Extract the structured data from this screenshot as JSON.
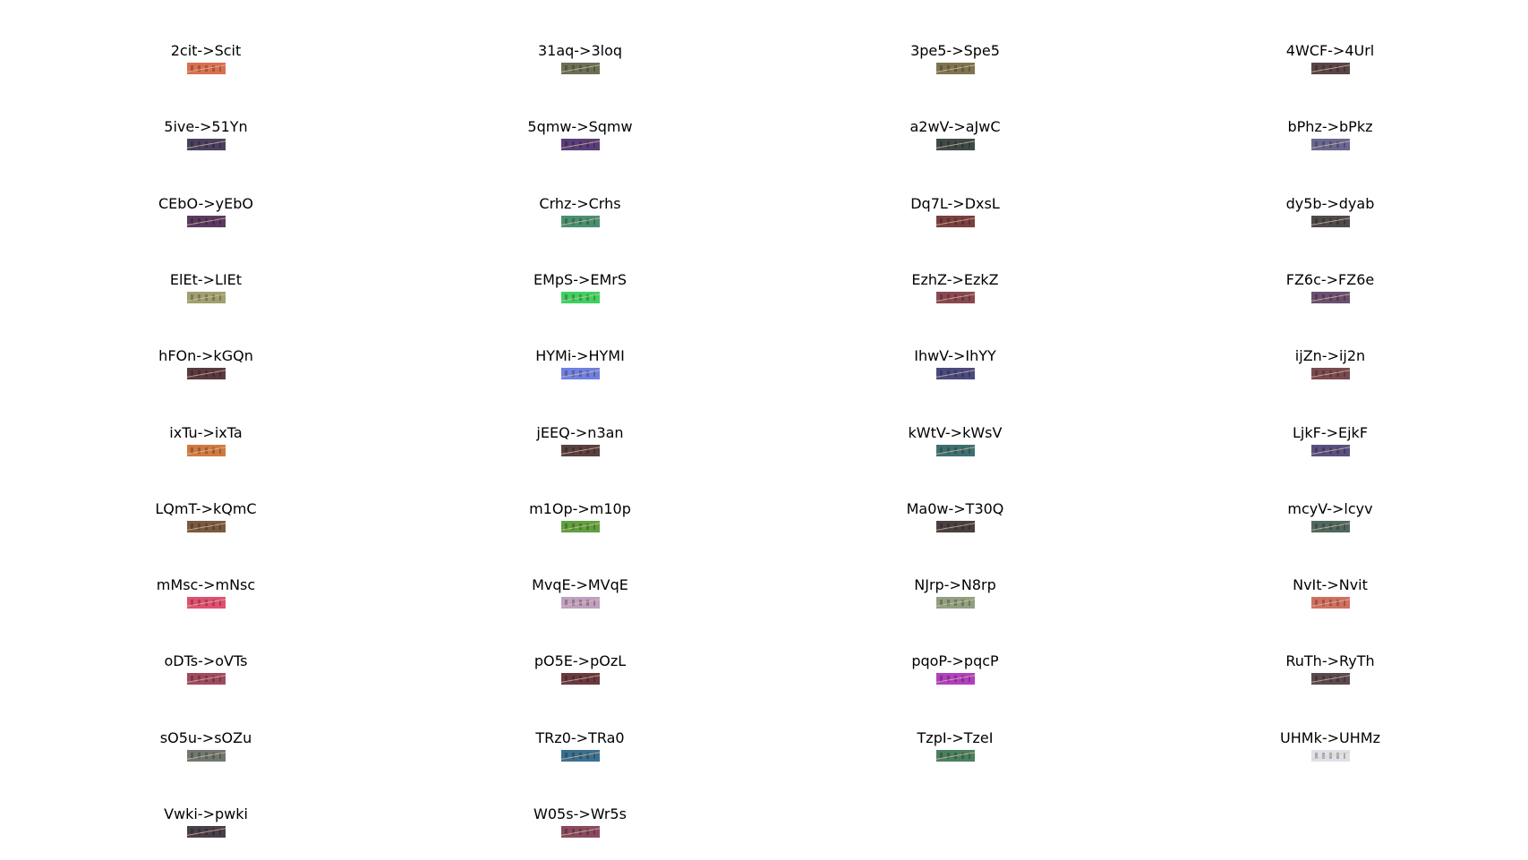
{
  "panels": [
    {
      "label": "2cit->Scit",
      "color": "#d9704f"
    },
    {
      "label": "31aq->3loq",
      "color": "#6b7055"
    },
    {
      "label": "3pe5->Spe5",
      "color": "#7e7550"
    },
    {
      "label": "4WCF->4Url",
      "color": "#5a4448"
    },
    {
      "label": "5ive->51Yn",
      "color": "#4a4060"
    },
    {
      "label": "5qmw->Sqmw",
      "color": "#5a3e7a"
    },
    {
      "label": "a2wV->aJwC",
      "color": "#3f4a48"
    },
    {
      "label": "bPhz->bPkz",
      "color": "#6a6890"
    },
    {
      "label": "CEbO->yEbO",
      "color": "#5a3a60"
    },
    {
      "label": "Crhz->Crhs",
      "color": "#4a9070"
    },
    {
      "label": "Dq7L->DxsL",
      "color": "#7a3f40"
    },
    {
      "label": "dy5b->dyab",
      "color": "#4f4a4c"
    },
    {
      "label": "ElEt->LIEt",
      "color": "#a0a070"
    },
    {
      "label": "EMpS->EMrS",
      "color": "#40d060"
    },
    {
      "label": "EzhZ->EzkZ",
      "color": "#8a4850"
    },
    {
      "label": "FZ6c->FZ6e",
      "color": "#6a5070"
    },
    {
      "label": "hFOn->kGQn",
      "color": "#5a3a40"
    },
    {
      "label": "HYMi->HYMI",
      "color": "#7080e0"
    },
    {
      "label": "IhwV->IhYY",
      "color": "#4a4a80"
    },
    {
      "label": "ijZn->ij2n",
      "color": "#7a4a50"
    },
    {
      "label": "ixTu->ixTa",
      "color": "#d07a40"
    },
    {
      "label": "jEEQ->n3an",
      "color": "#5a4040"
    },
    {
      "label": "kWtV->kWsV",
      "color": "#3f7070"
    },
    {
      "label": "LjkF->EjkF",
      "color": "#5a5080"
    },
    {
      "label": "LQmT->kQmC",
      "color": "#7a5a40"
    },
    {
      "label": "m1Op->m10p",
      "color": "#60a040"
    },
    {
      "label": "Ma0w->T30Q",
      "color": "#4a4040"
    },
    {
      "label": "mcyV->lcyv",
      "color": "#506860"
    },
    {
      "label": "mMsc->mNsc",
      "color": "#e05070"
    },
    {
      "label": "MvqE->MVqE",
      "color": "#c0a0c0"
    },
    {
      "label": "NJrp->N8rp",
      "color": "#90a080"
    },
    {
      "label": "NvIt->Nvit",
      "color": "#d07060"
    },
    {
      "label": "oDTs->oVTs",
      "color": "#a04a60"
    },
    {
      "label": "pO5E->pOzL",
      "color": "#6a3a40"
    },
    {
      "label": "pqoP->pqcP",
      "color": "#b040c0"
    },
    {
      "label": "RuTh->RyTh",
      "color": "#5a4a50"
    },
    {
      "label": "sO5u->sOZu",
      "color": "#707870"
    },
    {
      "label": "TRz0->TRa0",
      "color": "#3a7090"
    },
    {
      "label": "TzpI->TzeI",
      "color": "#4a8060"
    },
    {
      "label": "UHMk->UHMz",
      "color": "#e0e0e8"
    },
    {
      "label": "Vwki->pwki",
      "color": "#4a4048"
    },
    {
      "label": "W05s->Wr5s",
      "color": "#8a4a60"
    }
  ]
}
